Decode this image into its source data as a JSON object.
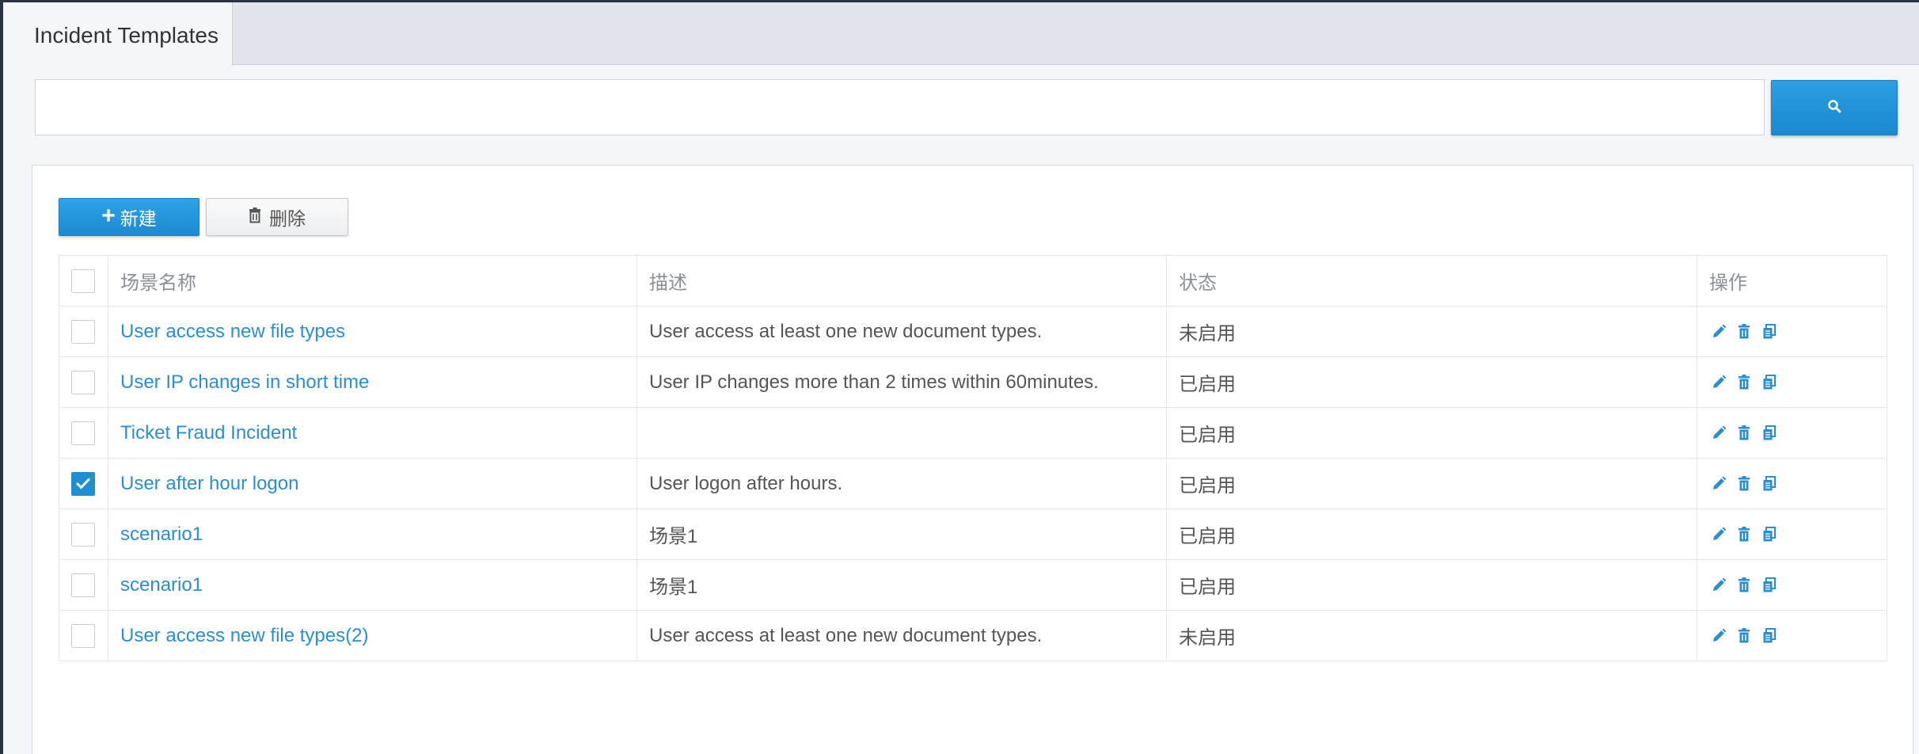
{
  "tab": {
    "title": "Incident Templates"
  },
  "search": {
    "placeholder": "",
    "value": ""
  },
  "toolbar": {
    "new_label": "新建",
    "delete_label": "删除"
  },
  "table": {
    "headers": {
      "name": "场景名称",
      "description": "描述",
      "status": "状态",
      "actions": "操作"
    },
    "rows": [
      {
        "checked": false,
        "name": "User access new file types",
        "description": "User access at least one new document types.",
        "status": "未启用"
      },
      {
        "checked": false,
        "name": "User IP changes in short time",
        "description": "User IP changes more than 2 times within 60minutes.",
        "status": "已启用"
      },
      {
        "checked": false,
        "name": "Ticket Fraud Incident",
        "description": "",
        "status": "已启用"
      },
      {
        "checked": true,
        "name": "User after hour logon",
        "description": "User logon after hours.",
        "status": "已启用"
      },
      {
        "checked": false,
        "name": "scenario1",
        "description": "场景1",
        "status": "已启用"
      },
      {
        "checked": false,
        "name": "scenario1",
        "description": "场景1",
        "status": "已启用"
      },
      {
        "checked": false,
        "name": "User access new file types(2)",
        "description": "User access at least one new document types.",
        "status": "未启用"
      }
    ]
  },
  "icons": {
    "search": "search-icon",
    "plus": "plus-icon",
    "trash": "trash-icon",
    "edit": "pencil-icon",
    "delete": "trash-icon",
    "copy": "copy-icon",
    "check": "checkmark-icon"
  },
  "colors": {
    "accent": "#1f8fd3",
    "link": "#2a8fd0"
  }
}
